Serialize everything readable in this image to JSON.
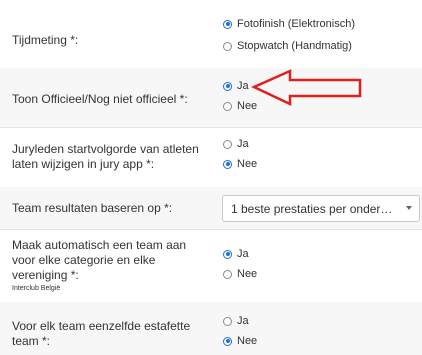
{
  "settings": [
    {
      "label": "Tijdmeting *:",
      "options": [
        {
          "label": "Fotofinish (Elektronisch)",
          "selected": true
        },
        {
          "label": "Stopwatch (Handmatig)",
          "selected": false
        }
      ]
    },
    {
      "label": "Toon Officieel/Nog niet officieel *:",
      "options": [
        {
          "label": "Ja",
          "selected": true
        },
        {
          "label": "Nee",
          "selected": false
        }
      ]
    },
    {
      "label_lines": [
        "Juryleden startvolgorde van atleten",
        "laten wijzigen in jury app *:"
      ],
      "options": [
        {
          "label": "Ja",
          "selected": false
        },
        {
          "label": "Nee",
          "selected": true
        }
      ]
    },
    {
      "label": "Team resultaten baseren op *:",
      "select_value": "1 beste prestaties per onder…"
    },
    {
      "label_lines": [
        "Maak automatisch een team aan",
        "voor elke categorie en elke",
        "vereniging *:"
      ],
      "note": "Interclub België",
      "options": [
        {
          "label": "Ja",
          "selected": true
        },
        {
          "label": "Nee",
          "selected": false
        }
      ]
    },
    {
      "label_lines": [
        "Voor elk team eenzelfde estafette",
        "team *:"
      ],
      "options": [
        {
          "label": "Ja",
          "selected": false
        },
        {
          "label": "Nee",
          "selected": true
        }
      ]
    }
  ],
  "colors": {
    "accent": "#1e6fd9",
    "annotation_arrow": "#e0201c",
    "row_alt": "#f7f7f7"
  }
}
